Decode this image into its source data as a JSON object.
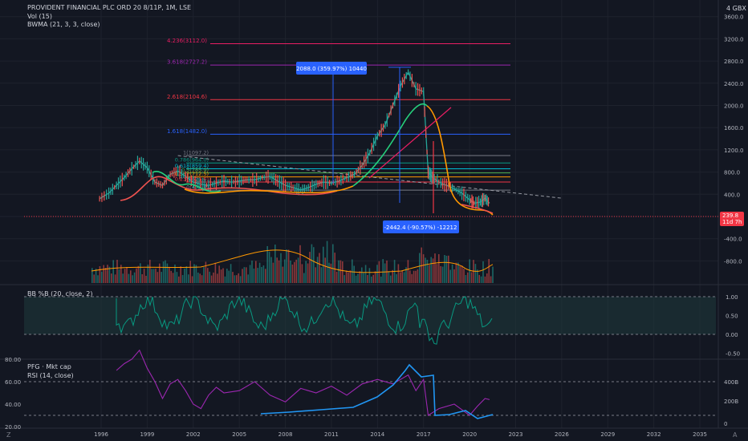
{
  "header": {
    "symbol_line": "PROVIDENT FINANCIAL PLC ORD 20 8/11P, 1M, LSE",
    "vol_line": "Vol (15)",
    "bwma_line": "BWMA (21, 3, 3, close)"
  },
  "currency_badge": "4 GBX",
  "current_price": {
    "value": "239.8",
    "countdown": "11d 7h"
  },
  "colors": {
    "background": "#131722",
    "up": "#26a69a",
    "down": "#ef5350",
    "price_line": "#f23645"
  },
  "main_axis": {
    "ticks": [
      "3600.0",
      "3200.0",
      "2800.0",
      "2400.0",
      "2000.0",
      "1600.0",
      "1200.0",
      "800.0",
      "400.0",
      "0.0",
      "-400.0",
      "-800.0"
    ]
  },
  "fib_levels": [
    {
      "label": "4.236(3112.0)",
      "price": 3112.0,
      "color": "#e91e63"
    },
    {
      "label": "3.618(2727.2)",
      "price": 2727.2,
      "color": "#9c27b0"
    },
    {
      "label": "2.618(2104.6)",
      "price": 2104.6,
      "color": "#f23645"
    },
    {
      "label": "1.618(1482.0)",
      "price": 1482.0,
      "color": "#2962ff"
    },
    {
      "label": "1(1097.2)",
      "price": 1097.2,
      "color": "#787b86"
    },
    {
      "label": "0.786(964.0)",
      "price": 964.0,
      "color": "#089981"
    },
    {
      "label": "0.618(859.4)",
      "price": 859.4,
      "color": "#00bcd4"
    },
    {
      "label": "0.5(785.9)",
      "price": 785.9,
      "color": "#4caf50"
    },
    {
      "label": "0.382(712.5)",
      "price": 712.5,
      "color": "#ff9800"
    },
    {
      "label": "0.236(621.6)",
      "price": 621.6,
      "color": "#f23645"
    },
    {
      "label": "0(474.8)",
      "price": 474.8,
      "color": "#787b86"
    }
  ],
  "measure_up": {
    "label": "2088.0 (359.97%) 10440",
    "from": 600,
    "to": 2688
  },
  "measure_down": {
    "label": "-2442.4 (-90.57%) -12212",
    "from": 2688,
    "to": 246
  },
  "bb_panel": {
    "title": "BB %B (20, close, 2)",
    "ticks": [
      "1.00",
      "0.50",
      "0.00",
      "-0.50"
    ]
  },
  "rsi_panel": {
    "title_line1": "PFG · Mkt cap",
    "title_line2": "RSI (14, close)",
    "left_ticks": [
      "80.00",
      "60.00",
      "40.00",
      "20.00"
    ],
    "right_ticks": [
      "400B",
      "200B",
      "0"
    ]
  },
  "time_axis": {
    "ticks": [
      "1996",
      "1999",
      "2002",
      "2005",
      "2008",
      "2011",
      "2014",
      "2017",
      "2020",
      "2023",
      "2026",
      "2029",
      "2032",
      "2035"
    ]
  },
  "corner_labels": {
    "left": "Z",
    "right": "A"
  },
  "chart_data": {
    "type": "line",
    "title": "PROVIDENT FINANCIAL PLC ORD 20 8/11P, 1M, LSE",
    "ylabel": "GBX",
    "ylim": [
      -1000,
      3800
    ],
    "series": [
      {
        "name": "PROVIDENT FINANCIAL PLC ORD 20 8/11P",
        "x": [
          1995.9,
          1996.5,
          1997.0,
          1997.5,
          1998.0,
          1998.5,
          1999.0,
          1999.5,
          2000.0,
          2000.5,
          2001.0,
          2001.5,
          2002.0,
          2002.5,
          2003.0,
          2003.5,
          2004.0,
          2004.5,
          2005.0,
          2005.5,
          2006.0,
          2006.5,
          2007.0,
          2007.5,
          2008.0,
          2008.5,
          2009.0,
          2009.5,
          2010.0,
          2010.5,
          2011.0,
          2011.5,
          2012.0,
          2012.5,
          2013.0,
          2013.5,
          2014.0,
          2014.5,
          2015.0,
          2015.5,
          2016.0,
          2016.5,
          2017.0,
          2017.3,
          2017.6,
          2018.0,
          2018.5,
          2019.0,
          2019.5,
          2020.0,
          2020.3,
          2020.7,
          2021.0,
          2021.3
        ],
        "values": [
          320,
          420,
          560,
          700,
          860,
          1000,
          880,
          620,
          560,
          760,
          820,
          720,
          620,
          580,
          560,
          600,
          640,
          620,
          640,
          660,
          660,
          700,
          720,
          640,
          560,
          520,
          480,
          520,
          580,
          620,
          600,
          640,
          700,
          760,
          920,
          1150,
          1450,
          1650,
          2000,
          2350,
          2600,
          2300,
          2250,
          800,
          700,
          620,
          560,
          500,
          420,
          300,
          240,
          260,
          330,
          240
        ]
      },
      {
        "name": "RSI (14, close)",
        "x": [
          1997.0,
          1997.5,
          1998.0,
          1998.5,
          1999.0,
          1999.5,
          2000.0,
          2000.5,
          2001.0,
          2001.5,
          2002.0,
          2002.5,
          2003.0,
          2003.5,
          2004.0,
          2005.0,
          2006.0,
          2007.0,
          2008.0,
          2009.0,
          2010.0,
          2011.0,
          2012.0,
          2013.0,
          2014.0,
          2015.0,
          2016.0,
          2016.5,
          2017.0,
          2017.3,
          2018.0,
          2019.0,
          2020.0,
          2020.5,
          2021.0,
          2021.3
        ],
        "values": [
          70,
          76,
          80,
          88,
          72,
          60,
          45,
          58,
          62,
          52,
          40,
          36,
          48,
          55,
          50,
          52,
          60,
          48,
          42,
          54,
          50,
          56,
          48,
          58,
          62,
          58,
          66,
          52,
          62,
          30,
          36,
          40,
          30,
          38,
          45,
          44
        ]
      }
    ]
  }
}
